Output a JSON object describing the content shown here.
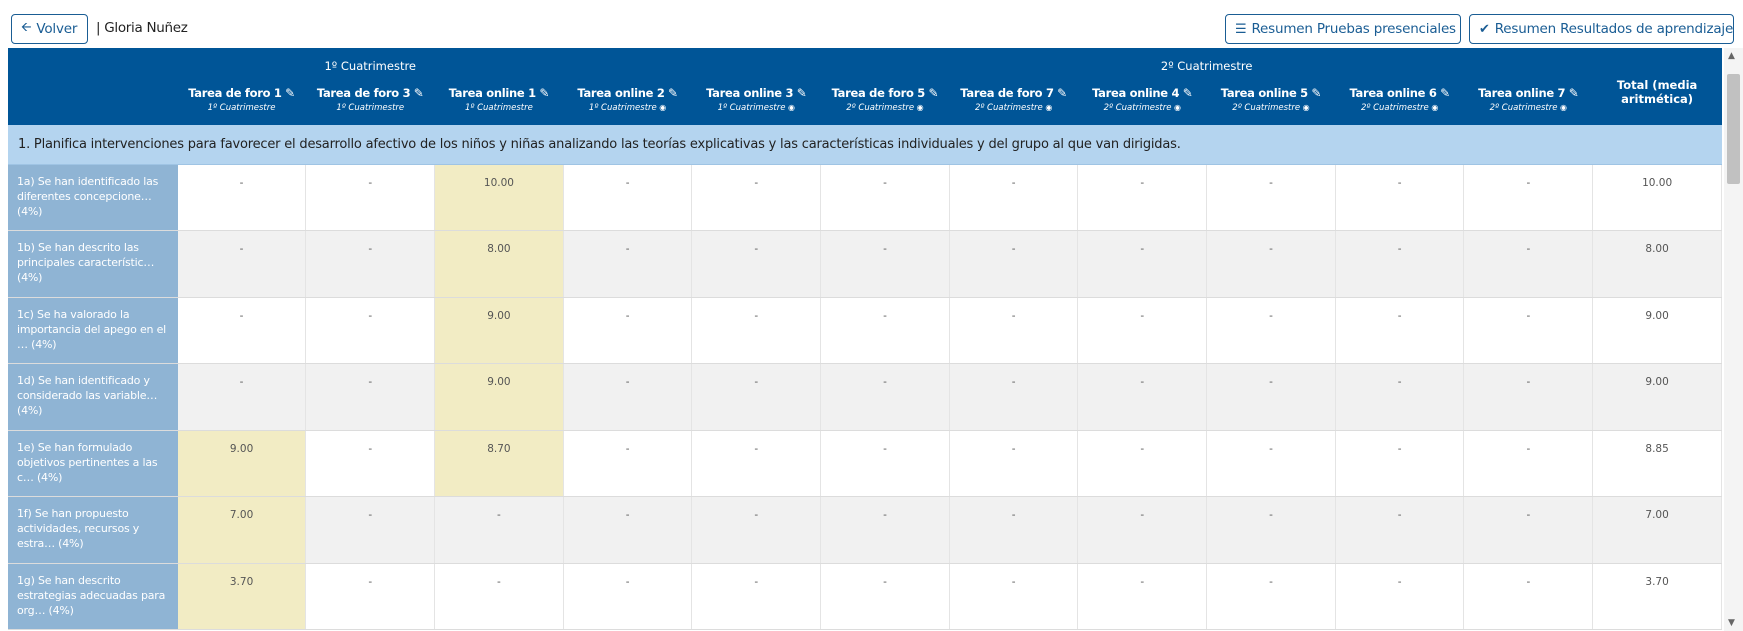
{
  "topbar": {
    "back_label": "Volver",
    "student_name": "| Gloria Nuñez",
    "pruebas_label": "Resumen Pruebas presenciales",
    "resultados_label": "Resumen Resultados de aprendizaje"
  },
  "table": {
    "semesters": [
      "1º Cuatrimestre",
      "2º Cuatrimestre"
    ],
    "columns": [
      {
        "name": "Tarea de foro 1",
        "sub": "1º Cuatrimestre",
        "eye": false
      },
      {
        "name": "Tarea de foro 3",
        "sub": "1º Cuatrimestre",
        "eye": false
      },
      {
        "name": "Tarea online 1",
        "sub": "1º Cuatrimestre",
        "eye": false
      },
      {
        "name": "Tarea online 2",
        "sub": "1º Cuatrimestre",
        "eye": true
      },
      {
        "name": "Tarea online 3",
        "sub": "1º Cuatrimestre",
        "eye": true
      },
      {
        "name": "Tarea de foro 5",
        "sub": "2º Cuatrimestre",
        "eye": true
      },
      {
        "name": "Tarea de foro 7",
        "sub": "2º Cuatrimestre",
        "eye": true
      },
      {
        "name": "Tarea online 4",
        "sub": "2º Cuatrimestre",
        "eye": true
      },
      {
        "name": "Tarea online 5",
        "sub": "2º Cuatrimestre",
        "eye": true
      },
      {
        "name": "Tarea online 6",
        "sub": "2º Cuatrimestre",
        "eye": true
      },
      {
        "name": "Tarea online 7",
        "sub": "2º Cuatrimestre",
        "eye": true
      }
    ],
    "total_header": "Total (media aritmética)",
    "section_title": "1. Planifica intervenciones para favorecer el desarrollo afectivo de los niños y niñas analizando las teorías explicativas y las características individuales y del grupo al que van dirigidas.",
    "rows": [
      {
        "label": "1a) Se han identificado las diferentes concepcione… (4%)",
        "values": [
          "-",
          "-",
          "10.00",
          "-",
          "-",
          "-",
          "-",
          "-",
          "-",
          "-",
          "-"
        ],
        "total": "10.00"
      },
      {
        "label": "1b) Se han descrito las principales característic… (4%)",
        "values": [
          "-",
          "-",
          "8.00",
          "-",
          "-",
          "-",
          "-",
          "-",
          "-",
          "-",
          "-"
        ],
        "total": "8.00"
      },
      {
        "label": "1c) Se ha valorado la importancia del apego en el … (4%)",
        "values": [
          "-",
          "-",
          "9.00",
          "-",
          "-",
          "-",
          "-",
          "-",
          "-",
          "-",
          "-"
        ],
        "total": "9.00"
      },
      {
        "label": "1d) Se han identificado y considerado las variable… (4%)",
        "values": [
          "-",
          "-",
          "9.00",
          "-",
          "-",
          "-",
          "-",
          "-",
          "-",
          "-",
          "-"
        ],
        "total": "9.00"
      },
      {
        "label": "1e) Se han formulado objetivos pertinentes a las c… (4%)",
        "values": [
          "9.00",
          "-",
          "8.70",
          "-",
          "-",
          "-",
          "-",
          "-",
          "-",
          "-",
          "-"
        ],
        "total": "8.85"
      },
      {
        "label": "1f) Se han propuesto actividades, recursos y estra… (4%)",
        "values": [
          "7.00",
          "-",
          "-",
          "-",
          "-",
          "-",
          "-",
          "-",
          "-",
          "-",
          "-"
        ],
        "total": "7.00"
      },
      {
        "label": "1g) Se han descrito estrategias adecuadas para org… (4%)",
        "values": [
          "3.70",
          "-",
          "-",
          "-",
          "-",
          "-",
          "-",
          "-",
          "-",
          "-",
          "-"
        ],
        "total": "3.70"
      }
    ]
  }
}
